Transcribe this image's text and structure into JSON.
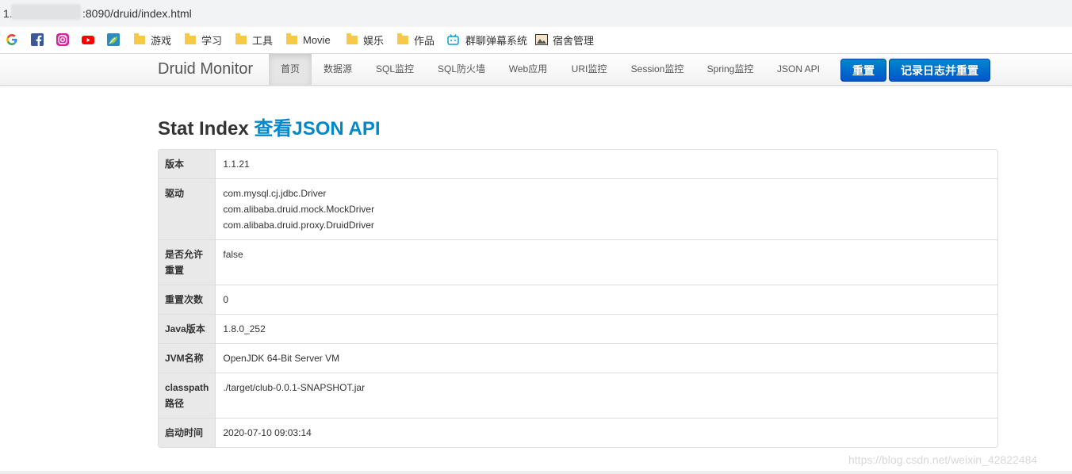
{
  "browser": {
    "url_prefix": "1.",
    "url_rest": ":8090/druid/index.html"
  },
  "bookmarks": [
    {
      "label": "游戏",
      "icon": "folder-icon"
    },
    {
      "label": "学习",
      "icon": "folder-icon"
    },
    {
      "label": "工具",
      "icon": "folder-icon"
    },
    {
      "label": "Movie",
      "icon": "folder-icon"
    },
    {
      "label": "娱乐",
      "icon": "folder-icon"
    },
    {
      "label": "作品",
      "icon": "folder-icon"
    },
    {
      "label": "群聊弹幕系统",
      "icon": "bilibili-icon"
    },
    {
      "label": "宿舍管理",
      "icon": "picture-icon"
    }
  ],
  "bookmark_icons": [
    "google-icon",
    "facebook-icon",
    "instagram-icon",
    "youtube-icon",
    "leaf-icon"
  ],
  "nav": {
    "brand": "Druid Monitor",
    "tabs": [
      "首页",
      "数据源",
      "SQL监控",
      "SQL防火墙",
      "Web应用",
      "URI监控",
      "Session监控",
      "Spring监控",
      "JSON API"
    ],
    "active_tab": "首页",
    "reset_button": "重置",
    "log_reset_button": "记录日志并重置"
  },
  "page": {
    "title": "Stat Index",
    "title_link": "查看JSON API"
  },
  "table": [
    {
      "label": "版本",
      "values": [
        "1.1.21"
      ]
    },
    {
      "label": "驱动",
      "values": [
        "com.mysql.cj.jdbc.Driver",
        "com.alibaba.druid.mock.MockDriver",
        "com.alibaba.druid.proxy.DruidDriver"
      ]
    },
    {
      "label": "是否允许重置",
      "values": [
        "false"
      ]
    },
    {
      "label": "重置次数",
      "values": [
        "0"
      ]
    },
    {
      "label": "Java版本",
      "values": [
        "1.8.0_252"
      ]
    },
    {
      "label": "JVM名称",
      "values": [
        "OpenJDK 64-Bit Server VM"
      ]
    },
    {
      "label": "classpath路径",
      "values": [
        "./target/club-0.0.1-SNAPSHOT.jar"
      ]
    },
    {
      "label": "启动时间",
      "values": [
        "2020-07-10 09:03:14"
      ]
    }
  ],
  "watermark": "https://blog.csdn.net/weixin_42822484",
  "colors": {
    "link": "#0088cc",
    "button": "#0066cc"
  }
}
